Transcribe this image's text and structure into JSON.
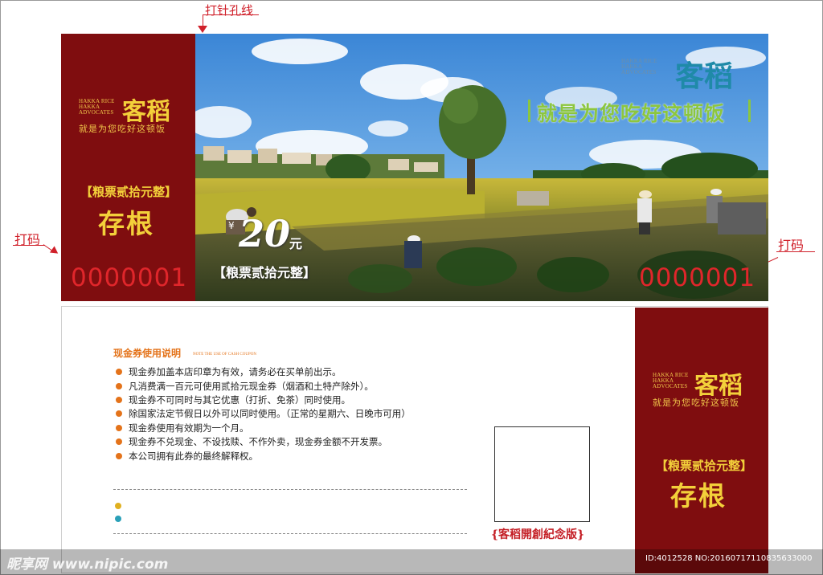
{
  "annotations": {
    "perforation": "打针孔线",
    "number_left": "打码",
    "number_right": "打码"
  },
  "top_stub": {
    "brand_en": [
      "HAKKA RICE",
      "HAKKA",
      "ADVOCATES"
    ],
    "brand_cn": "客稻",
    "tagline": "就是为您吃好这顿饭",
    "label": "【粮票贰拾元整】",
    "title": "存根",
    "serial": "0000001"
  },
  "top_photo": {
    "brand_en": [
      "HAKKA RICE",
      "HAKKA",
      "ADVOCATES"
    ],
    "brand_cn": "客稻",
    "headline": "就是为您吃好这顿饭",
    "price_symbol": "¥",
    "price": "20",
    "price_unit": "元",
    "label": "【粮票贰拾元整】",
    "serial": "0000001"
  },
  "bottom_ticket": {
    "rules_title": "现金券使用说明",
    "rules_subtitle": "NOTE THE USE OF CASH COUPON",
    "rules": [
      "现金券加盖本店印章为有效，请务必在买单前出示。",
      "凡消费满一百元可使用贰拾元现金券（烟酒和土特产除外）。",
      "现金券不可同时与其它优惠（打折、免茶）同时使用。",
      "除国家法定节假日以外可以同时使用。（正常的星期六、日晚市可用）",
      "现金券使用有效期为一个月。",
      "现金券不兑现金、不设找赎、不作外卖，现金券金额不开发票。",
      "本公司拥有此券的最终解释权。"
    ],
    "stamp_caption": "{客稻開創紀念版}"
  },
  "bottom_stub": {
    "brand_en": [
      "HAKKA RICE",
      "HAKKA",
      "ADVOCATES"
    ],
    "brand_cn": "客稻",
    "tagline": "就是为您吃好这顿饭",
    "label": "【粮票贰拾元整】",
    "title": "存根"
  },
  "watermark": {
    "logo": "昵享网 www.nipic.com",
    "id_text": "ID:4012528 NO:20160717110835633000"
  },
  "colors": {
    "maroon": "#7f0d0f",
    "gold": "#f3d03a",
    "serial_red": "#e0262b",
    "headline_green": "#8cc63f",
    "brand_teal": "#1f8aa8",
    "bullet_orange": "#e4731a"
  }
}
